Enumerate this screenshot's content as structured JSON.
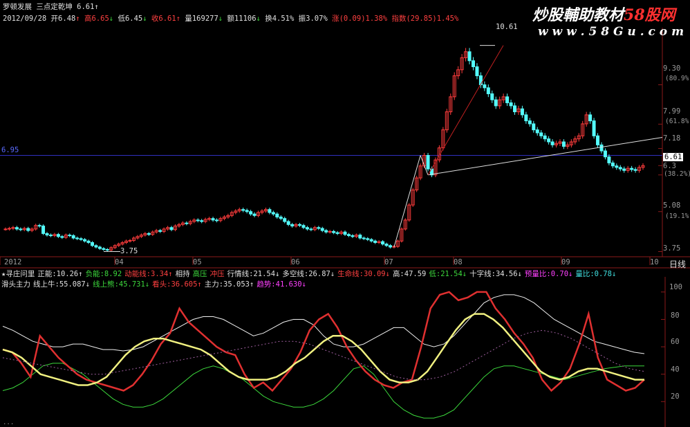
{
  "header": {
    "stock_name": "罗顿发展",
    "indicator": "三点定乾坤",
    "indicator_value": "6.61",
    "arrow_up": "↑",
    "arrow_down": "↓",
    "date": "2012/09/28",
    "open": "开6.48",
    "high": "高6.65",
    "low": "低6.45",
    "close": "收6.61",
    "volume": "量169277",
    "amount": "额11106",
    "turnover": "换4.51%",
    "amplitude": "振3.07%",
    "change": "涨(0.09)1.38%",
    "index": "指数(29.85)1.45%"
  },
  "watermark": {
    "title_a": "炒股輔助教材",
    "title_b": "58股网",
    "url": "w w w . 5 8 G u . c o m"
  },
  "price_axis": {
    "labels": [
      "9.30",
      "(80.9%)",
      "7.99",
      "(61.8%)",
      "7.18",
      "6.61",
      "6.3",
      "(38.2%)",
      "5.08",
      "(19.1%)",
      "3.75"
    ],
    "left_level": "6.95",
    "high_marker": "10.61",
    "low_marker": "3.75"
  },
  "time_axis": {
    "labels": [
      "2012",
      "04",
      "05",
      "06",
      "07",
      "08",
      "09",
      "10"
    ],
    "period": "日线"
  },
  "indicator_bar1": {
    "items": [
      {
        "text": "★寻庄问里",
        "color": "#e0e0e0"
      },
      {
        "text": "正能:10.26↑",
        "color": "#e0e0e0"
      },
      {
        "text": "负能:8.92",
        "color": "#3cd83c"
      },
      {
        "text": "动能线:3.34↑",
        "color": "#ff4040"
      },
      {
        "text": "相持",
        "color": "#e0e0e0"
      },
      {
        "text": "高压",
        "color": "#3cd83c"
      },
      {
        "text": "冲压",
        "color": "#ff4040"
      },
      {
        "text": "行情线:21.54↓",
        "color": "#e0e0e0"
      },
      {
        "text": "多空线:26.87↓",
        "color": "#e0e0e0"
      },
      {
        "text": "生命线:30.09↓",
        "color": "#ff4040"
      },
      {
        "text": "高:47.59",
        "color": "#e0e0e0"
      },
      {
        "text": "低:21.54↓",
        "color": "#3cd83c"
      },
      {
        "text": "十字线:34.56↓",
        "color": "#e0e0e0"
      },
      {
        "text": "预量比:0.70↓",
        "color": "#ff40ff"
      },
      {
        "text": "量比:0.78↓",
        "color": "#40e0e0"
      }
    ]
  },
  "indicator_bar2": {
    "items": [
      {
        "text": "滑头主力",
        "color": "#e0e0e0"
      },
      {
        "text": "线上牛:55.087↓",
        "color": "#e0e0e0"
      },
      {
        "text": "线上熊:45.731↓",
        "color": "#3cd83c"
      },
      {
        "text": "看头:36.605↑",
        "color": "#ff4040"
      },
      {
        "text": "主力:35.053↑",
        "color": "#e0e0e0"
      },
      {
        "text": "趋势:41.630↓",
        "color": "#ff40ff"
      }
    ]
  },
  "bottom_partial": "...",
  "chart_data": [
    {
      "type": "candlestick",
      "title": "罗顿发展 三点定乾坤",
      "y_axis_labels": [
        9.3,
        7.99,
        7.18,
        6.61,
        6.3,
        5.08,
        3.75
      ],
      "ylim": [
        3.6,
        11.2
      ],
      "annotations": {
        "high": 10.61,
        "low": 3.75,
        "level": 6.95
      },
      "x_months": [
        "2012",
        "04",
        "05",
        "06",
        "07",
        "08",
        "09",
        "10"
      ],
      "close_path": [
        4.5,
        4.52,
        4.55,
        4.5,
        4.48,
        4.52,
        4.45,
        4.5,
        4.62,
        4.6,
        4.35,
        4.3,
        4.28,
        4.32,
        4.25,
        4.22,
        4.3,
        4.28,
        4.2,
        4.18,
        4.15,
        4.1,
        4.05,
        3.95,
        3.9,
        3.85,
        3.82,
        3.8,
        3.88,
        3.95,
        4.0,
        4.05,
        4.1,
        4.12,
        4.2,
        4.25,
        4.3,
        4.35,
        4.32,
        4.4,
        4.45,
        4.42,
        4.5,
        4.55,
        4.48,
        4.6,
        4.65,
        4.7,
        4.68,
        4.75,
        4.8,
        4.78,
        4.75,
        4.82,
        4.85,
        4.8,
        4.78,
        4.85,
        4.9,
        4.95,
        5.05,
        5.1,
        5.15,
        5.12,
        5.08,
        5.0,
        4.95,
        5.05,
        5.1,
        5.15,
        5.05,
        5.0,
        4.9,
        4.85,
        4.75,
        4.65,
        4.6,
        4.65,
        4.62,
        4.55,
        4.5,
        4.48,
        4.55,
        4.52,
        4.45,
        4.4,
        4.42,
        4.38,
        4.35,
        4.4,
        4.32,
        4.28,
        4.25,
        4.3,
        4.2,
        4.18,
        4.15,
        4.1,
        4.05,
        4.08,
        4.0,
        3.95,
        3.9,
        3.92,
        4.1,
        4.5,
        4.8,
        5.3,
        5.8,
        6.2,
        6.6,
        6.95,
        6.5,
        6.3,
        6.8,
        7.2,
        7.8,
        8.4,
        8.9,
        9.6,
        9.8,
        10.2,
        10.4,
        10.1,
        9.9,
        9.6,
        9.3,
        9.2,
        9.0,
        8.8,
        8.6,
        8.8,
        8.9,
        8.7,
        8.6,
        8.4,
        8.5,
        8.3,
        8.1,
        8.0,
        7.8,
        7.7,
        7.6,
        7.5,
        7.4,
        7.3,
        7.35,
        7.4,
        7.25,
        7.3,
        7.4,
        7.5,
        7.6,
        8.0,
        8.3,
        8.1,
        7.6,
        7.3,
        7.1,
        6.9,
        6.7,
        6.6,
        6.55,
        6.5,
        6.45,
        6.52,
        6.48,
        6.45,
        6.55,
        6.61
      ]
    },
    {
      "type": "line",
      "title": "滑头主力",
      "y_axis_labels": [
        100.0,
        80.0,
        60.0,
        40.0,
        20.0
      ],
      "ylim": [
        5,
        105
      ],
      "series": [
        {
          "name": "线上牛",
          "color": "#f0f0f0",
          "values": [
            75,
            72,
            68,
            64,
            62,
            60,
            60,
            62,
            62,
            60,
            58,
            58,
            57,
            58,
            60,
            64,
            68,
            72,
            76,
            80,
            82,
            82,
            80,
            76,
            72,
            68,
            70,
            74,
            78,
            80,
            80,
            76,
            68,
            62,
            60,
            60,
            62,
            66,
            70,
            74,
            74,
            68,
            62,
            60,
            62,
            68,
            76,
            84,
            92,
            96,
            98,
            98,
            96,
            92,
            86,
            80,
            76,
            72,
            68,
            64,
            62,
            60,
            58,
            56,
            55
          ]
        },
        {
          "name": "线上熊",
          "color": "#3cd83c",
          "values": [
            28,
            30,
            34,
            40,
            46,
            48,
            48,
            44,
            40,
            34,
            28,
            22,
            18,
            16,
            16,
            18,
            22,
            28,
            34,
            40,
            44,
            46,
            44,
            40,
            36,
            30,
            24,
            20,
            18,
            16,
            16,
            18,
            22,
            28,
            36,
            44,
            46,
            40,
            30,
            20,
            14,
            10,
            8,
            8,
            10,
            14,
            22,
            30,
            38,
            44,
            46,
            46,
            44,
            42,
            40,
            38,
            36,
            38,
            40,
            42,
            44,
            45,
            46,
            46,
            46
          ]
        },
        {
          "name": "看头",
          "color": "#e03030",
          "values": [
            58,
            56,
            48,
            38,
            68,
            60,
            52,
            46,
            40,
            36,
            34,
            32,
            30,
            28,
            32,
            40,
            50,
            62,
            70,
            88,
            78,
            72,
            66,
            60,
            56,
            54,
            40,
            30,
            34,
            28,
            36,
            44,
            56,
            72,
            80,
            84,
            74,
            60,
            50,
            42,
            36,
            32,
            30,
            34,
            36,
            60,
            88,
            98,
            100,
            94,
            96,
            100,
            100,
            88,
            80,
            70,
            62,
            52,
            36,
            28,
            34,
            44,
            62,
            84,
            52,
            36,
            32,
            28,
            30,
            36
          ]
        },
        {
          "name": "主力",
          "color": "#f0f080",
          "values": [
            58,
            56,
            52,
            46,
            40,
            38,
            36,
            34,
            32,
            32,
            34,
            38,
            46,
            54,
            60,
            64,
            66,
            66,
            64,
            62,
            60,
            58,
            54,
            48,
            42,
            38,
            36,
            36,
            36,
            38,
            42,
            48,
            52,
            58,
            64,
            68,
            68,
            64,
            58,
            50,
            42,
            36,
            34,
            34,
            36,
            42,
            52,
            62,
            72,
            80,
            84,
            84,
            80,
            74,
            66,
            58,
            50,
            42,
            38,
            36,
            38,
            42,
            44,
            44,
            42,
            40,
            38,
            36,
            36
          ]
        },
        {
          "name": "趋势",
          "color": "#a060a0",
          "values": [
            52,
            50,
            48,
            46,
            44,
            42,
            40,
            40,
            42,
            44,
            46,
            48,
            50,
            52,
            54,
            56,
            58,
            60,
            62,
            64,
            64,
            62,
            58,
            54,
            50,
            46,
            42,
            38,
            36,
            36,
            38,
            42,
            48,
            54,
            60,
            66,
            70,
            72,
            70,
            66,
            60,
            54,
            48,
            44,
            42
          ]
        }
      ]
    }
  ]
}
